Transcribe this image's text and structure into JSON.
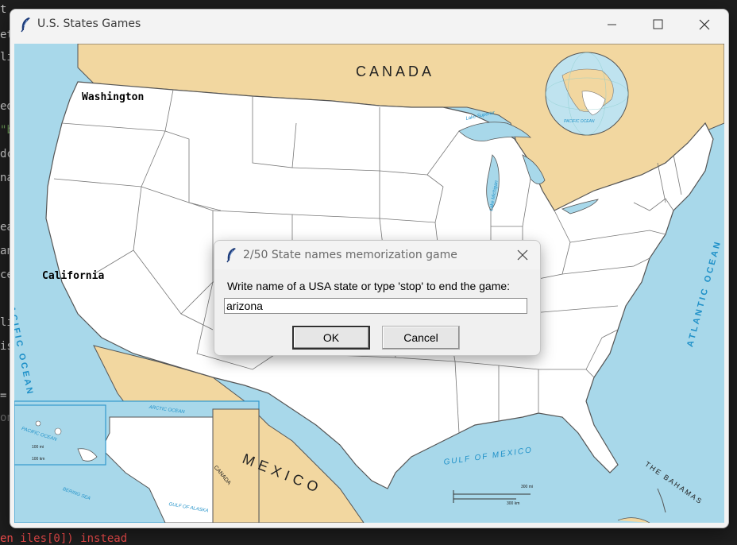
{
  "background": {
    "code_fragments": [
      "t",
      "et",
      "li",
      "ed",
      "\"b",
      "dc",
      "na",
      "ea",
      "an",
      "ce",
      "",
      "li",
      "is",
      "=",
      "on"
    ],
    "error_text": "en iles[0]) instead"
  },
  "window": {
    "title": "U.S. States Games",
    "icon": "feather-icon",
    "controls": [
      "minimize-icon",
      "maximize-icon",
      "close-icon"
    ]
  },
  "map": {
    "guessed_states": [
      {
        "name": "Washington"
      },
      {
        "name": "California"
      }
    ],
    "labels": {
      "canada": "CANADA",
      "mexico": "MEXICO",
      "pacific": "PACIFIC OCEAN",
      "atlantic": "ATLANTIC OCEAN",
      "gulf": "GULF OF MEXICO",
      "bahamas": "THE BAHAMAS",
      "lake_superior": "Lake Superior",
      "lake_michigan": "Lake Michigan",
      "arctic": "ARCTIC OCEAN",
      "pacific_small": "PACIFIC OCEAN",
      "bering": "BERING SEA",
      "gulf_alaska": "GULF OF ALASKA",
      "canada_small": "CANADA",
      "pacific_globe": "PACIFIC OCEAN",
      "scale_100mi": "100 mi",
      "scale_100km": "100 km",
      "scale_mi": "300 mi",
      "scale_km": "300 km"
    },
    "colors": {
      "ocean": "#a8d8ea",
      "land_foreign": "#f2d7a0",
      "state_fill": "#ffffff",
      "border": "#555555"
    }
  },
  "dialog": {
    "title": "2/50 State names memorization game",
    "prompt": "Write name of a USA state or type 'stop' to end the game:",
    "input_value": "arizona",
    "ok_label": "OK",
    "cancel_label": "Cancel"
  }
}
